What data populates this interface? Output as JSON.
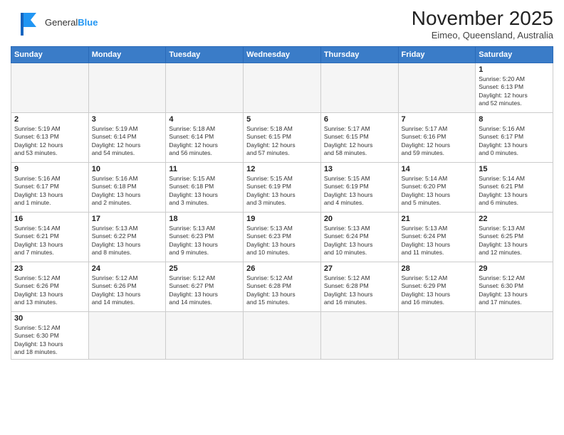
{
  "logo": {
    "line1": "General",
    "line2": "Blue"
  },
  "header": {
    "month": "November 2025",
    "location": "Eimeo, Queensland, Australia"
  },
  "days_of_week": [
    "Sunday",
    "Monday",
    "Tuesday",
    "Wednesday",
    "Thursday",
    "Friday",
    "Saturday"
  ],
  "weeks": [
    [
      {
        "day": null,
        "info": null
      },
      {
        "day": null,
        "info": null
      },
      {
        "day": null,
        "info": null
      },
      {
        "day": null,
        "info": null
      },
      {
        "day": null,
        "info": null
      },
      {
        "day": null,
        "info": null
      },
      {
        "day": "1",
        "info": "Sunrise: 5:20 AM\nSunset: 6:13 PM\nDaylight: 12 hours\nand 52 minutes."
      }
    ],
    [
      {
        "day": "2",
        "info": "Sunrise: 5:19 AM\nSunset: 6:13 PM\nDaylight: 12 hours\nand 53 minutes."
      },
      {
        "day": "3",
        "info": "Sunrise: 5:19 AM\nSunset: 6:14 PM\nDaylight: 12 hours\nand 54 minutes."
      },
      {
        "day": "4",
        "info": "Sunrise: 5:18 AM\nSunset: 6:14 PM\nDaylight: 12 hours\nand 56 minutes."
      },
      {
        "day": "5",
        "info": "Sunrise: 5:18 AM\nSunset: 6:15 PM\nDaylight: 12 hours\nand 57 minutes."
      },
      {
        "day": "6",
        "info": "Sunrise: 5:17 AM\nSunset: 6:15 PM\nDaylight: 12 hours\nand 58 minutes."
      },
      {
        "day": "7",
        "info": "Sunrise: 5:17 AM\nSunset: 6:16 PM\nDaylight: 12 hours\nand 59 minutes."
      },
      {
        "day": "8",
        "info": "Sunrise: 5:16 AM\nSunset: 6:17 PM\nDaylight: 13 hours\nand 0 minutes."
      }
    ],
    [
      {
        "day": "9",
        "info": "Sunrise: 5:16 AM\nSunset: 6:17 PM\nDaylight: 13 hours\nand 1 minute."
      },
      {
        "day": "10",
        "info": "Sunrise: 5:16 AM\nSunset: 6:18 PM\nDaylight: 13 hours\nand 2 minutes."
      },
      {
        "day": "11",
        "info": "Sunrise: 5:15 AM\nSunset: 6:18 PM\nDaylight: 13 hours\nand 3 minutes."
      },
      {
        "day": "12",
        "info": "Sunrise: 5:15 AM\nSunset: 6:19 PM\nDaylight: 13 hours\nand 3 minutes."
      },
      {
        "day": "13",
        "info": "Sunrise: 5:15 AM\nSunset: 6:19 PM\nDaylight: 13 hours\nand 4 minutes."
      },
      {
        "day": "14",
        "info": "Sunrise: 5:14 AM\nSunset: 6:20 PM\nDaylight: 13 hours\nand 5 minutes."
      },
      {
        "day": "15",
        "info": "Sunrise: 5:14 AM\nSunset: 6:21 PM\nDaylight: 13 hours\nand 6 minutes."
      }
    ],
    [
      {
        "day": "16",
        "info": "Sunrise: 5:14 AM\nSunset: 6:21 PM\nDaylight: 13 hours\nand 7 minutes."
      },
      {
        "day": "17",
        "info": "Sunrise: 5:13 AM\nSunset: 6:22 PM\nDaylight: 13 hours\nand 8 minutes."
      },
      {
        "day": "18",
        "info": "Sunrise: 5:13 AM\nSunset: 6:23 PM\nDaylight: 13 hours\nand 9 minutes."
      },
      {
        "day": "19",
        "info": "Sunrise: 5:13 AM\nSunset: 6:23 PM\nDaylight: 13 hours\nand 10 minutes."
      },
      {
        "day": "20",
        "info": "Sunrise: 5:13 AM\nSunset: 6:24 PM\nDaylight: 13 hours\nand 10 minutes."
      },
      {
        "day": "21",
        "info": "Sunrise: 5:13 AM\nSunset: 6:24 PM\nDaylight: 13 hours\nand 11 minutes."
      },
      {
        "day": "22",
        "info": "Sunrise: 5:13 AM\nSunset: 6:25 PM\nDaylight: 13 hours\nand 12 minutes."
      }
    ],
    [
      {
        "day": "23",
        "info": "Sunrise: 5:12 AM\nSunset: 6:26 PM\nDaylight: 13 hours\nand 13 minutes."
      },
      {
        "day": "24",
        "info": "Sunrise: 5:12 AM\nSunset: 6:26 PM\nDaylight: 13 hours\nand 14 minutes."
      },
      {
        "day": "25",
        "info": "Sunrise: 5:12 AM\nSunset: 6:27 PM\nDaylight: 13 hours\nand 14 minutes."
      },
      {
        "day": "26",
        "info": "Sunrise: 5:12 AM\nSunset: 6:28 PM\nDaylight: 13 hours\nand 15 minutes."
      },
      {
        "day": "27",
        "info": "Sunrise: 5:12 AM\nSunset: 6:28 PM\nDaylight: 13 hours\nand 16 minutes."
      },
      {
        "day": "28",
        "info": "Sunrise: 5:12 AM\nSunset: 6:29 PM\nDaylight: 13 hours\nand 16 minutes."
      },
      {
        "day": "29",
        "info": "Sunrise: 5:12 AM\nSunset: 6:30 PM\nDaylight: 13 hours\nand 17 minutes."
      }
    ],
    [
      {
        "day": "30",
        "info": "Sunrise: 5:12 AM\nSunset: 6:30 PM\nDaylight: 13 hours\nand 18 minutes."
      },
      {
        "day": null,
        "info": null
      },
      {
        "day": null,
        "info": null
      },
      {
        "day": null,
        "info": null
      },
      {
        "day": null,
        "info": null
      },
      {
        "day": null,
        "info": null
      },
      {
        "day": null,
        "info": null
      }
    ]
  ]
}
